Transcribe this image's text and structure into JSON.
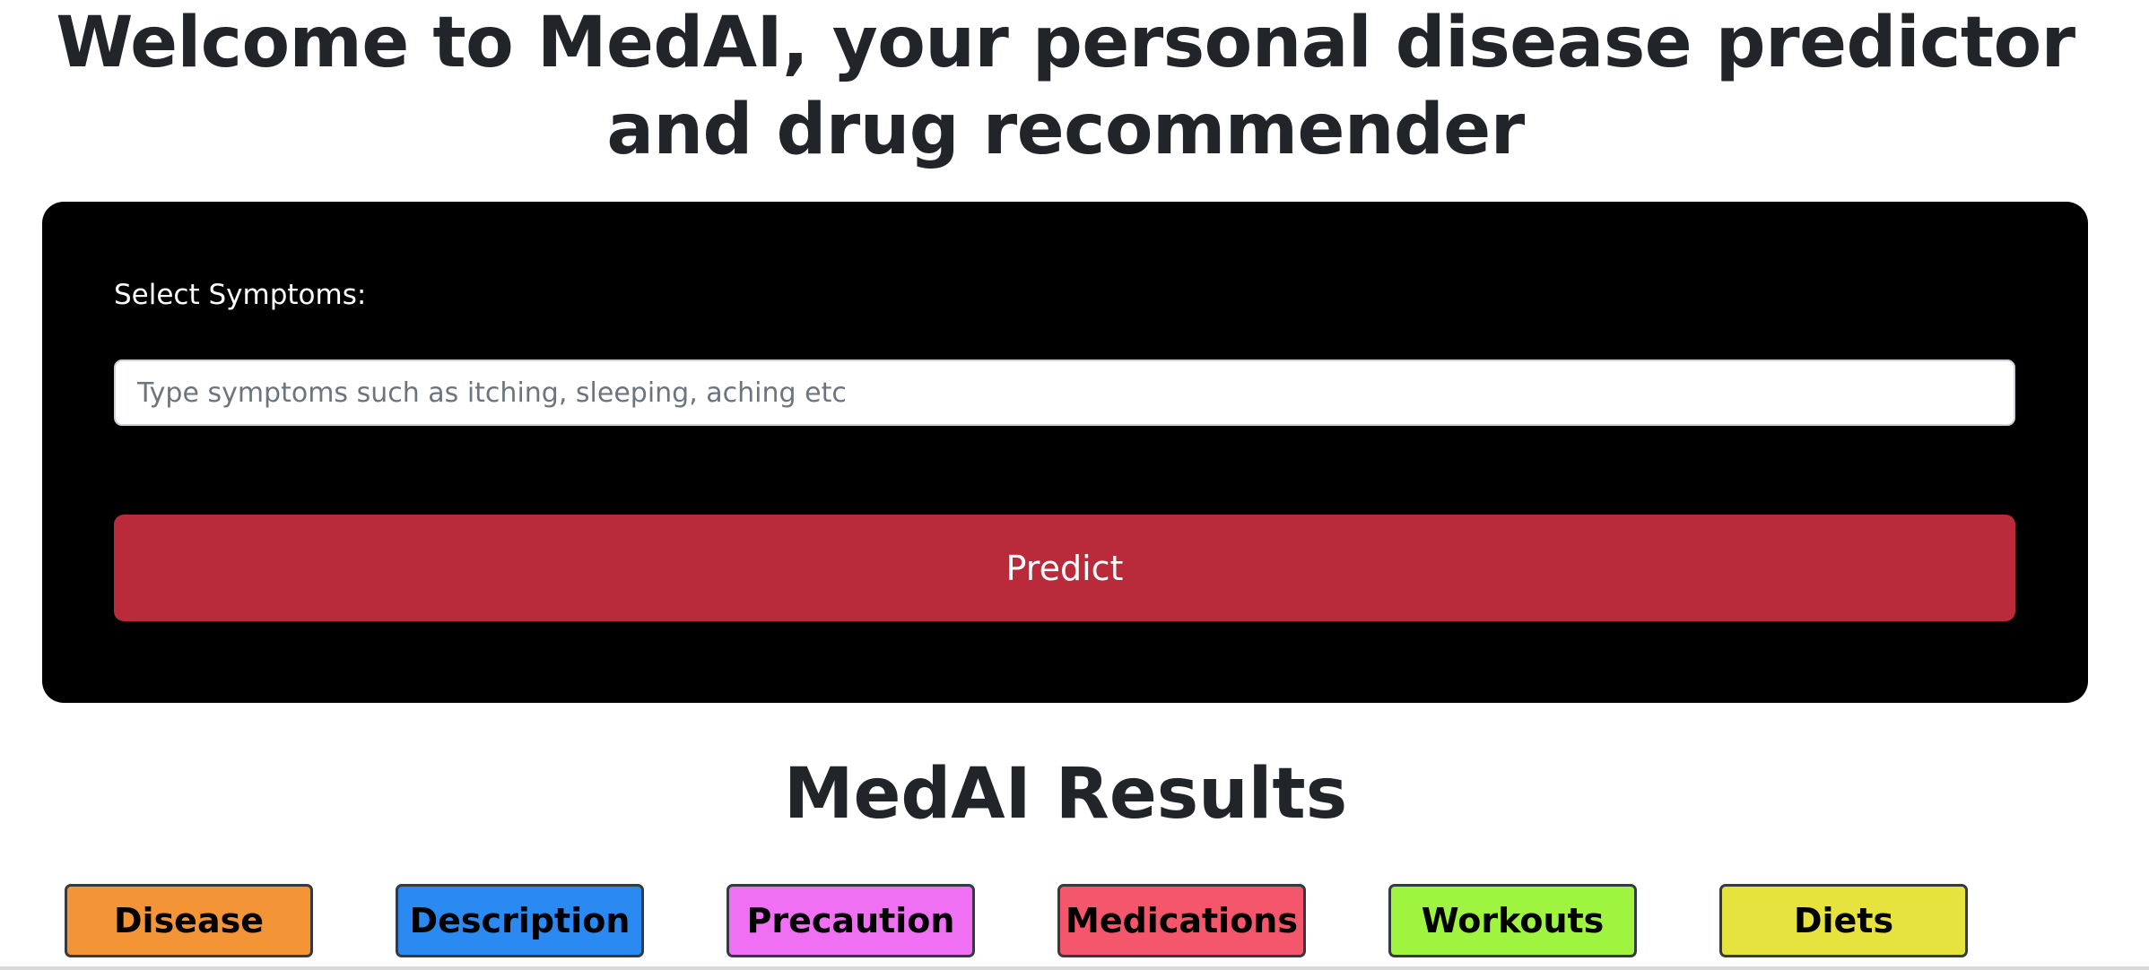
{
  "header": {
    "title": "Welcome to MedAI, your personal disease predictor and drug recommender"
  },
  "form": {
    "label": "Select Symptoms:",
    "input_value": "",
    "input_placeholder": "Type symptoms such as itching, sleeping, aching etc",
    "predict_label": "Predict",
    "predict_color": "#b92b3b"
  },
  "results": {
    "heading": "MedAI Results",
    "tabs": [
      {
        "label": "Disease",
        "color": "#f39437"
      },
      {
        "label": "Description",
        "color": "#2b8af2"
      },
      {
        "label": "Precaution",
        "color": "#f070f3"
      },
      {
        "label": "Medications",
        "color": "#f4566c"
      },
      {
        "label": "Workouts",
        "color": "#9ef43f"
      },
      {
        "label": "Diets",
        "color": "#e6e33f"
      }
    ]
  }
}
